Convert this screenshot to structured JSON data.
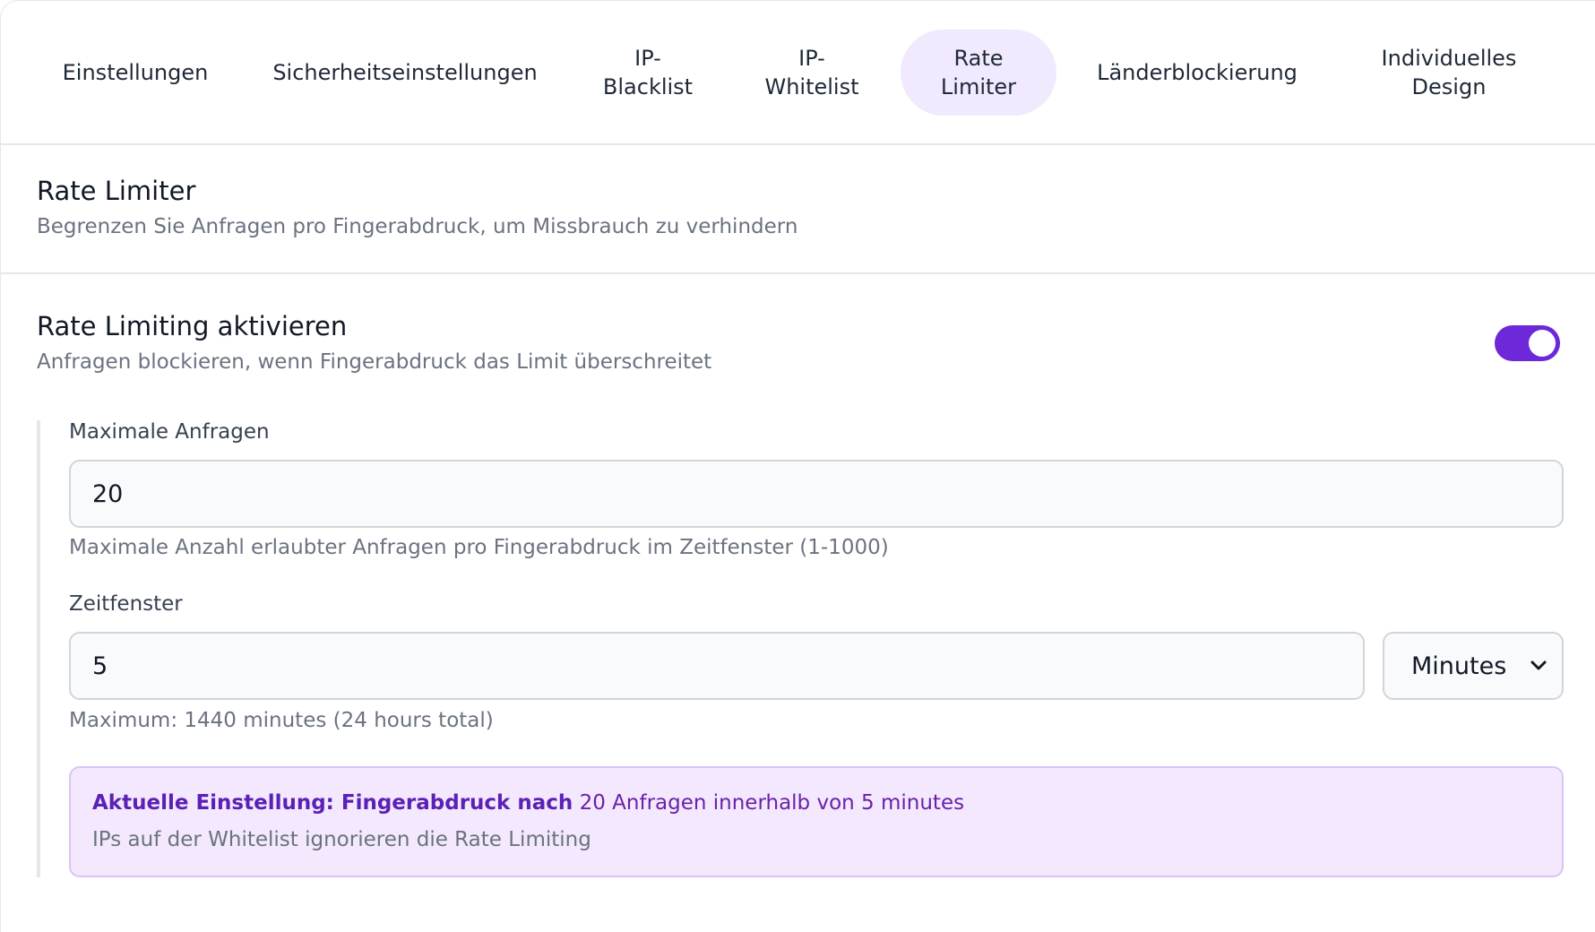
{
  "tabs": [
    {
      "label": "Einstellungen",
      "active": false
    },
    {
      "label": "Sicherheitseinstellungen",
      "active": false
    },
    {
      "label": "IP-\nBlacklist",
      "active": false
    },
    {
      "label": "IP-\nWhitelist",
      "active": false
    },
    {
      "label": "Rate\nLimiter",
      "active": true
    },
    {
      "label": "Länderblockierung",
      "active": false
    },
    {
      "label": "Individuelles\nDesign",
      "active": false
    }
  ],
  "section": {
    "title": "Rate Limiter",
    "subtitle": "Begrenzen Sie Anfragen pro Fingerabdruck, um Missbrauch zu verhindern"
  },
  "rate_limiting": {
    "title": "Rate Limiting aktivieren",
    "subtitle": "Anfragen blockieren, wenn Fingerabdruck das Limit überschreitet",
    "enabled": true
  },
  "max_requests": {
    "label": "Maximale Anfragen",
    "value": "20",
    "hint": "Maximale Anzahl erlaubter Anfragen pro Fingerabdruck im Zeitfenster (1-1000)"
  },
  "time_window": {
    "label": "Zeitfenster",
    "value": "5",
    "unit": "Minutes",
    "hint": "Maximum: 1440 minutes (24 hours total)"
  },
  "summary": {
    "prefix": "Aktuelle Einstellung: Fingerabdruck nach",
    "detail": " 20 Anfragen innerhalb von 5 minutes",
    "note": "IPs auf der Whitelist ignorieren die Rate Limiting"
  },
  "colors": {
    "accent": "#6d28d9",
    "active_tab_bg": "#f1e9fd",
    "info_bg": "#f3e8fd"
  }
}
